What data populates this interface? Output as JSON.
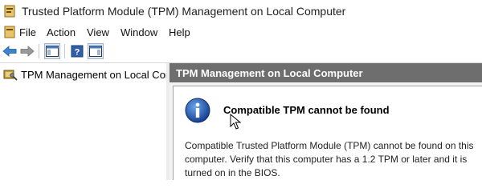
{
  "window": {
    "title": "Trusted Platform Module (TPM) Management on Local Computer"
  },
  "menu": {
    "items": [
      "File",
      "Action",
      "View",
      "Window",
      "Help"
    ]
  },
  "toolbar": {
    "icons": [
      "back-arrow-icon",
      "forward-arrow-icon",
      "show-hide-console-tree-icon",
      "help-icon",
      "show-hide-action-pane-icon"
    ]
  },
  "tree": {
    "items": [
      {
        "label": "TPM Management on Local Comp",
        "icon": "tpm-chip-icon"
      }
    ]
  },
  "content": {
    "header": "TPM Management on Local Computer",
    "message_title": "Compatible TPM cannot be found",
    "message_body": "Compatible Trusted Platform Module (TPM) cannot be found on this computer. Verify that this computer has a 1.2 TPM or later and it is turned on in the BIOS.",
    "icon": "info-icon"
  },
  "colors": {
    "header_bg": "#6e6e6e",
    "info_blue": "#1f5fbf"
  }
}
